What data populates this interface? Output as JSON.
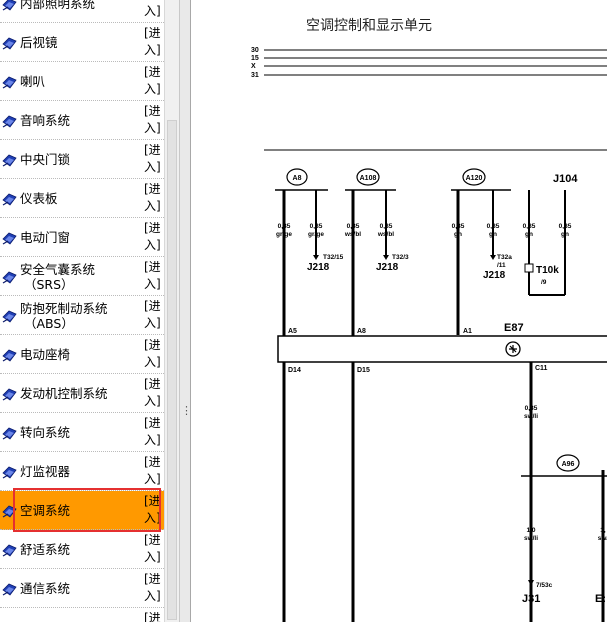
{
  "sidebar": {
    "enter_label": "[进入]",
    "items": [
      {
        "label": "内部照明系统"
      },
      {
        "label": "后视镜"
      },
      {
        "label": "喇叭"
      },
      {
        "label": "音响系统"
      },
      {
        "label": "中央门锁"
      },
      {
        "label": "仪表板"
      },
      {
        "label": "电动门窗"
      },
      {
        "label": "安全气囊系统",
        "sub": "（SRS）"
      },
      {
        "label": "防抱死制动系统",
        "sub": "（ABS）"
      },
      {
        "label": "电动座椅"
      },
      {
        "label": "发动机控制系统"
      },
      {
        "label": "转向系统"
      },
      {
        "label": "灯监视器"
      },
      {
        "label": "空调系统",
        "active": true
      },
      {
        "label": "舒适系统"
      },
      {
        "label": "通信系统"
      }
    ],
    "partial_bottom_enter": "[进"
  },
  "splitter": {
    "grip": "⋮"
  },
  "diagram": {
    "title": "空调控制和显示单元",
    "rails": [
      "30",
      "15",
      "X",
      "31"
    ],
    "connectors": {
      "a8": "A8",
      "a108": "A108",
      "a120": "A120",
      "a96": "A96"
    },
    "wires": {
      "w1": {
        "size": "0,35",
        "color": "gr/ge"
      },
      "w2": {
        "size": "0,35",
        "color": "gr/ge"
      },
      "w3": {
        "size": "0,35",
        "color": "ws/bl"
      },
      "w4": {
        "size": "0,35",
        "color": "ws/bl"
      },
      "w5": {
        "size": "0,35",
        "color": "gn"
      },
      "w6": {
        "size": "0,35",
        "color": "gn"
      },
      "w7": {
        "size": "0,35",
        "color": "gn"
      },
      "w8": {
        "size": "0,35",
        "color": "gn"
      },
      "w9": {
        "size": "0,35",
        "color": "sw/li"
      },
      "w10": {
        "size": "1,0",
        "color": "sw/li"
      },
      "w11": {
        "size": "1,",
        "color": "sw/"
      }
    },
    "labels": {
      "j104": "J104",
      "j218a": "J218",
      "t32_15": "T32/15",
      "j218b": "J218",
      "t32_3": "T32/3",
      "j218c": "J218",
      "t32a": "T32a",
      "t32a_sub": "/11",
      "t10k": "T10k",
      "t10k_sub": "/9",
      "e87": "E87",
      "pin_a5": "A5",
      "pin_a8": "A8",
      "pin_a1": "A1",
      "pin_d14": "D14",
      "pin_d15": "D15",
      "pin_c11": "C11",
      "pin_753c": "7/53c",
      "j31": "J31",
      "e_cut": "E:"
    }
  }
}
